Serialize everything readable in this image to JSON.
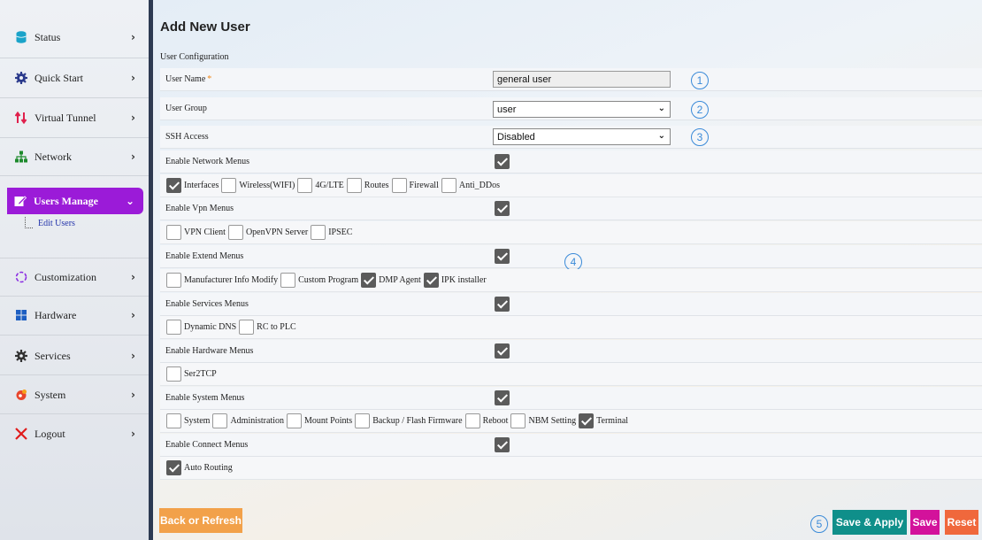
{
  "sidebar": {
    "items": [
      {
        "label": "Status",
        "icon": "database-icon"
      },
      {
        "label": "Quick Start",
        "icon": "gear-icon"
      },
      {
        "label": "Virtual Tunnel",
        "icon": "tunnel-arrows-icon"
      },
      {
        "label": "Network",
        "icon": "network-icon"
      },
      {
        "label": "Users Manage",
        "icon": "edit-icon"
      },
      {
        "label": "Customization",
        "icon": "spinner-icon"
      },
      {
        "label": "Hardware",
        "icon": "grid-icon"
      },
      {
        "label": "Services",
        "icon": "gear-icon"
      },
      {
        "label": "System",
        "icon": "system-icon"
      },
      {
        "label": "Logout",
        "icon": "close-icon"
      }
    ],
    "sub_item": "Edit Users",
    "active_color": "#9b1bd8"
  },
  "main": {
    "title": "Add New User",
    "section": "User Configuration",
    "user_name": {
      "label": "User Name",
      "required": "*",
      "value": "general user"
    },
    "user_group": {
      "label": "User Group",
      "value": "user"
    },
    "ssh_access": {
      "label": "SSH Access",
      "value": "Disabled"
    },
    "markers": [
      "1",
      "2",
      "3",
      "4",
      "5"
    ],
    "groups": [
      {
        "label": "Enable Network Menus",
        "enabled": true,
        "options": [
          {
            "label": "Interfaces",
            "checked": true
          },
          {
            "label": "Wireless(WIFI)",
            "checked": false
          },
          {
            "label": "4G/LTE",
            "checked": false
          },
          {
            "label": "Routes",
            "checked": false
          },
          {
            "label": "Firewall",
            "checked": false
          },
          {
            "label": "Anti_DDos",
            "checked": false
          }
        ]
      },
      {
        "label": "Enable Vpn Menus",
        "enabled": true,
        "options": [
          {
            "label": "VPN Client",
            "checked": false
          },
          {
            "label": "OpenVPN Server",
            "checked": false
          },
          {
            "label": "IPSEC",
            "checked": false
          }
        ]
      },
      {
        "label": "Enable Extend Menus",
        "enabled": true,
        "options": [
          {
            "label": "Manufacturer Info Modify",
            "checked": false
          },
          {
            "label": "Custom Program",
            "checked": false
          },
          {
            "label": "DMP Agent",
            "checked": true
          },
          {
            "label": "IPK installer",
            "checked": true
          }
        ]
      },
      {
        "label": "Enable Services Menus",
        "enabled": true,
        "options": [
          {
            "label": "Dynamic DNS",
            "checked": false
          },
          {
            "label": "RC to PLC",
            "checked": false
          }
        ]
      },
      {
        "label": "Enable Hardware Menus",
        "enabled": true,
        "options": [
          {
            "label": "Ser2TCP",
            "checked": false
          }
        ]
      },
      {
        "label": "Enable System Menus",
        "enabled": true,
        "options": [
          {
            "label": "System",
            "checked": false
          },
          {
            "label": "Administration",
            "checked": false
          },
          {
            "label": "Mount Points",
            "checked": false
          },
          {
            "label": "Backup / Flash Firmware",
            "checked": false
          },
          {
            "label": "Reboot",
            "checked": false
          },
          {
            "label": "NBM Setting",
            "checked": false
          },
          {
            "label": "Terminal",
            "checked": true
          }
        ]
      },
      {
        "label": "Enable Connect Menus",
        "enabled": true,
        "options": [
          {
            "label": "Auto Routing",
            "checked": true
          }
        ]
      }
    ]
  },
  "buttons": {
    "back": "Back or Refresh",
    "save_apply": "Save & Apply",
    "save": "Save",
    "reset": "Reset"
  },
  "colors": {
    "back": "#f2a14a",
    "save_apply": "#0f8f8a",
    "save": "#d3129b",
    "reset": "#f0683c",
    "marker": "#3a8ad8"
  }
}
